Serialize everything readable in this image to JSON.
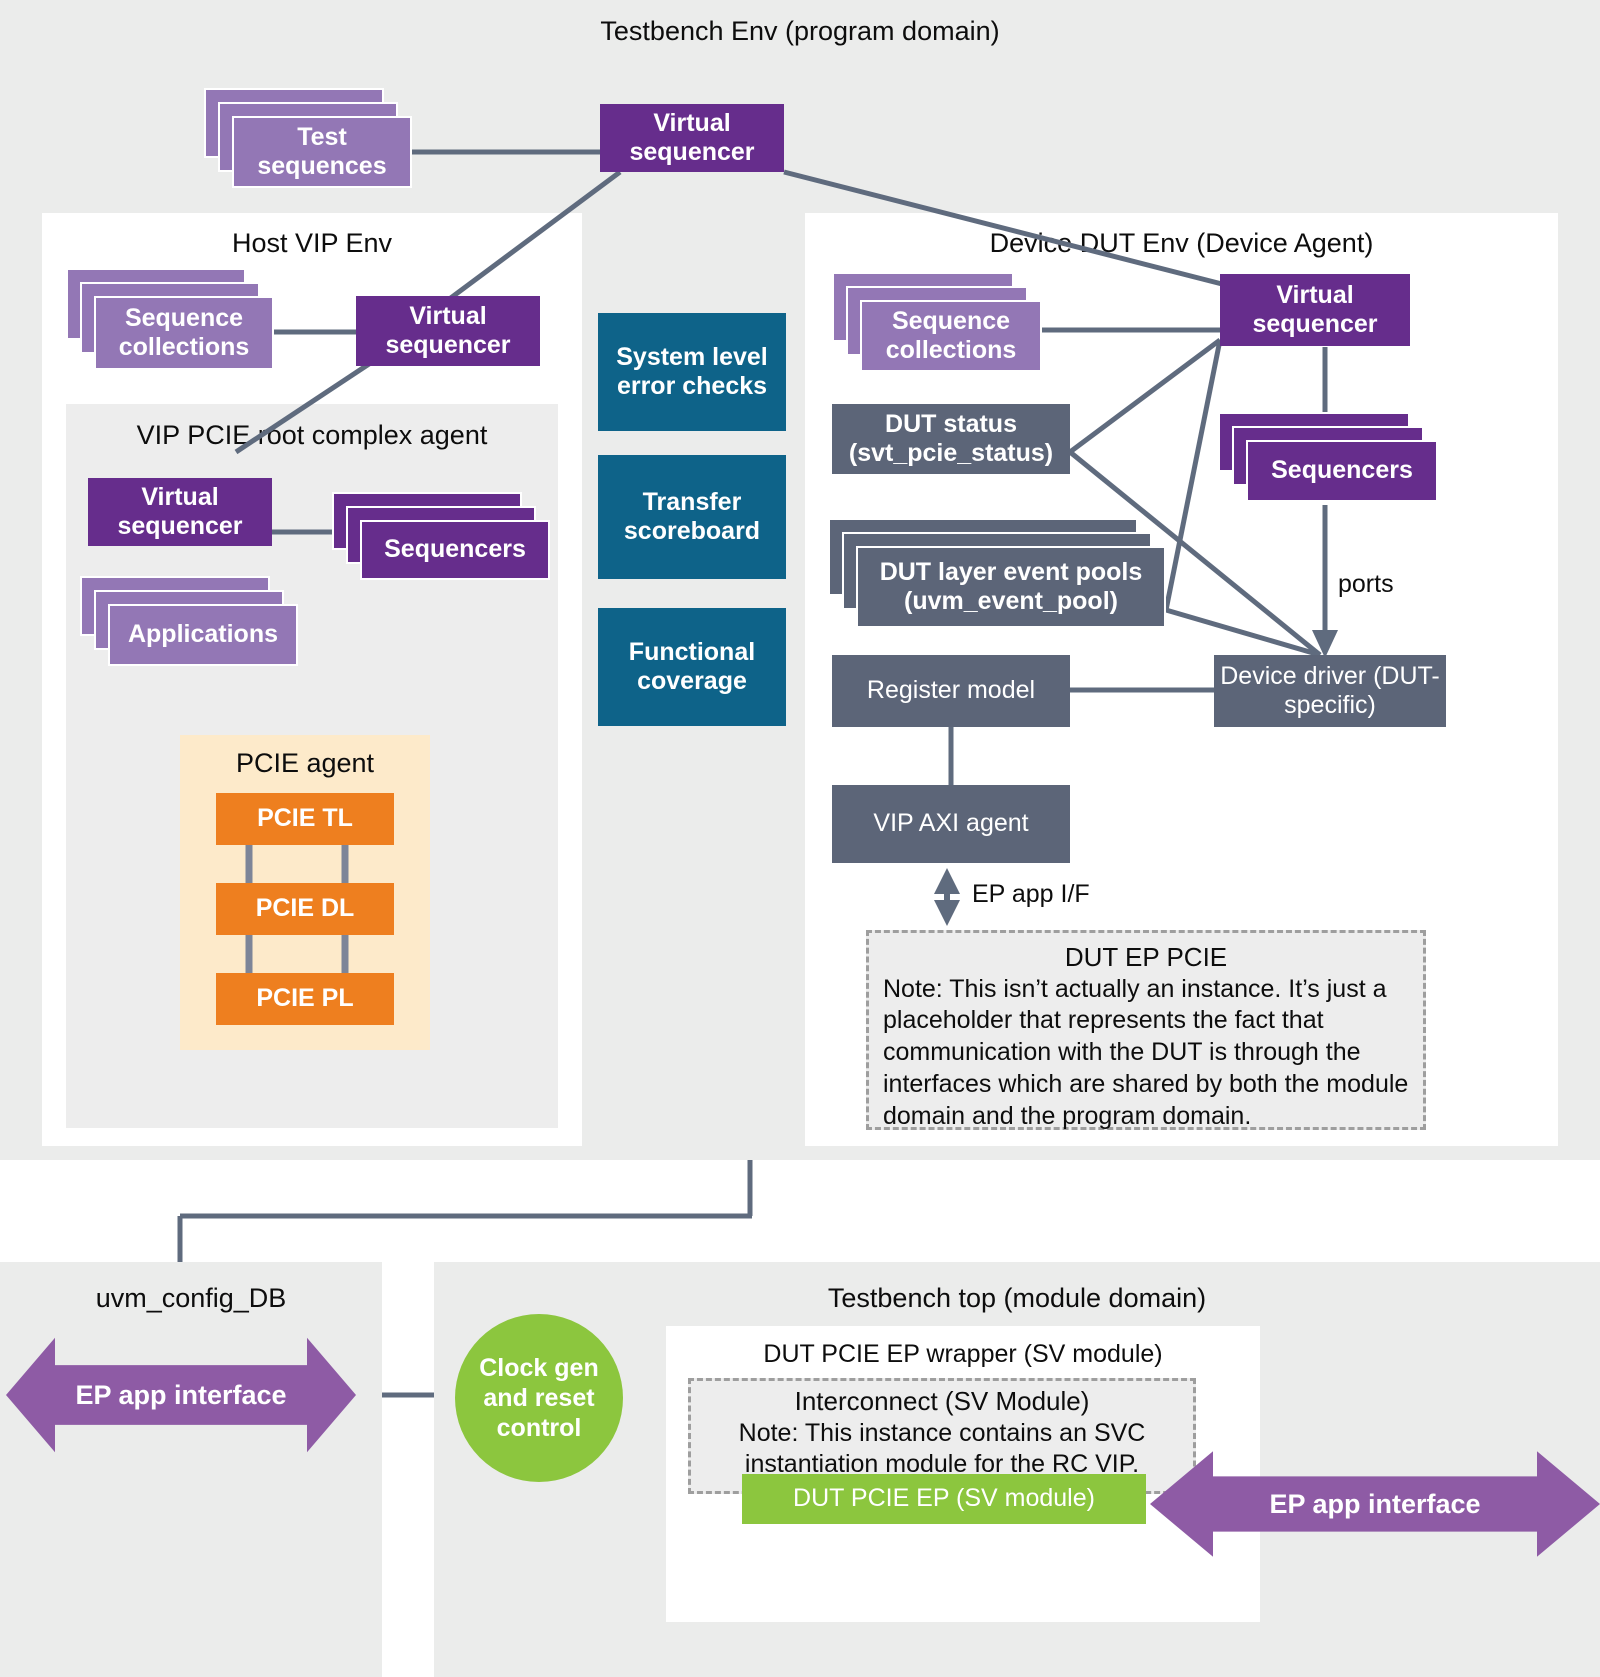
{
  "diagram": {
    "title": "Testbench Env (program domain)",
    "regions": {
      "host_vip_env": "Host VIP Env",
      "vip_pcie_rc_agent": "VIP PCIE root complex agent",
      "pcie_agent": "PCIE agent",
      "device_dut_env": "Device DUT Env (Device Agent)",
      "uvm_config_db": "uvm_config_DB",
      "testbench_top": "Testbench top (module domain)",
      "dut_pcie_ep_wrapper": "DUT PCIE EP wrapper (SV module)"
    },
    "nodes": {
      "test_sequences": "Test sequences",
      "virtual_sequencer_top": "Virtual sequencer",
      "sequence_collections_host": "Sequence collections",
      "virtual_sequencer_host": "Virtual sequencer",
      "virtual_sequencer_rc": "Virtual sequencer",
      "sequencers_rc": "Sequencers",
      "applications": "Applications",
      "pcie_tl": "PCIE TL",
      "pcie_dl": "PCIE DL",
      "pcie_pl": "PCIE PL",
      "system_level_error_checks": "System level error checks",
      "transfer_scoreboard": "Transfer scoreboard",
      "functional_coverage": "Functional coverage",
      "sequence_collections_dut": "Sequence collections",
      "virtual_sequencer_dut": "Virtual sequencer",
      "sequencers_dut": "Sequencers",
      "dut_status": "DUT status (svt_pcie_status)",
      "dut_layer_event_pools": "DUT layer event pools (uvm_event_pool)",
      "register_model": "Register model",
      "vip_axi_agent": "VIP AXI agent",
      "device_driver": "Device driver (DUT-specific)",
      "clock_gen_reset_control": "Clock gen and reset control",
      "dut_pcie_ep": "DUT PCIE EP (SV module)",
      "ep_app_interface_left": "EP app interface",
      "ep_app_interface_right": "EP app interface"
    },
    "edge_labels": {
      "ports": "ports",
      "ep_app_if": "EP app I/F"
    },
    "notes": {
      "dut_ep_pcie": {
        "title": "DUT EP PCIE",
        "body": "Note: This isn’t actually an instance. It’s just a placeholder that represents the fact that communication with the DUT is through the interfaces which are shared by both the module domain and the program domain."
      },
      "interconnect": {
        "title": "Interconnect (SV Module)",
        "body": "Note: This instance contains an SVC instantiation module for the RC VIP."
      }
    },
    "colors": {
      "purple_dark": "#662d8c",
      "purple_light": "#9377b5",
      "slate": "#5c6578",
      "teal": "#0e6389",
      "orange": "#ee7f1f",
      "green": "#8cc63e",
      "arrow_purple": "#8e5ba5",
      "panel_gray": "#ebeceb",
      "pcie_agent_bg": "#fdeaca",
      "connector": "#5f6b7e"
    }
  }
}
